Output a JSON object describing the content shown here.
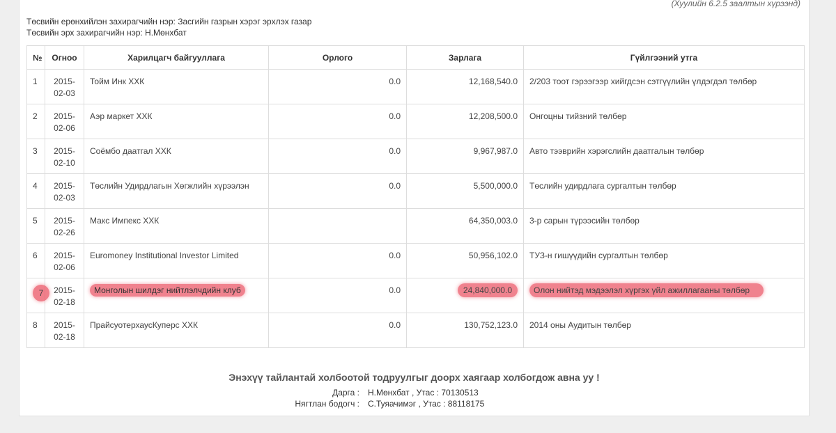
{
  "note": "(Хуулийн 6.2.5 заалтын хүрээнд)",
  "meta": {
    "line1": "Төсвийн ерөнхийлэн захирагчийн нэр: Засгийн газрын хэрэг эрхлэх газар",
    "line2": "Төсвийн эрх захирагчийн нэр: Н.Мөнхбат"
  },
  "table": {
    "headers": [
      "№",
      "Огноо",
      "Харилцагч байгууллага",
      "Орлого",
      "Зарлага",
      "Гүйлгээний утга"
    ],
    "rows": [
      {
        "no": "1",
        "date": "2015-\n02-03",
        "org": "Тойм Инк ХХК",
        "income": "0.0",
        "expense": "12,168,540.0",
        "purpose": "2/203 тоот гэрээгээр хийгдсэн сэтгүүлийн үлдэгдэл төлбөр"
      },
      {
        "no": "2",
        "date": "2015-\n02-06",
        "org": "Аэр маркет ХХК",
        "income": "0.0",
        "expense": "12,208,500.0",
        "purpose": "Онгоцны тийзний төлбөр"
      },
      {
        "no": "3",
        "date": "2015-\n02-10",
        "org": "Соёмбо даатгал ХХК",
        "income": "0.0",
        "expense": "9,967,987.0",
        "purpose": "Авто тээврийн хэрэгслийн даатгалын төлбөр"
      },
      {
        "no": "4",
        "date": "2015-\n02-03",
        "org": "Төслийн Удирдлагын Хөгжлийн хүрээлэн",
        "income": "0.0",
        "expense": "5,500,000.0",
        "purpose": "Төслийн удирдлага сургалтын төлбөр"
      },
      {
        "no": "5",
        "date": "2015-\n02-26",
        "org": "Макс Импекс ХХК",
        "income": "",
        "expense": "64,350,003.0",
        "purpose": "3-р сарын түрээсийн төлбөр"
      },
      {
        "no": "6",
        "date": "2015-\n02-06",
        "org": "Euromoney Institutional Investor Limited",
        "income": "0.0",
        "expense": "50,956,102.0",
        "purpose": "ТУЗ-н гишүүдийн сургалтын төлбөр"
      },
      {
        "no": "7",
        "date": "2015-\n02-18",
        "org": "Монголын шилдэг нийтлэлчдийн клуб",
        "income": "0.0",
        "expense": "24,840,000.0",
        "purpose": "Олон нийтэд мэдээлэл хүргэх үйл ажиллагааны төлбөр",
        "highlighted": true
      },
      {
        "no": "8",
        "date": "2015-\n02-18",
        "org": "ПрайсуотерхаусКуперс ХХК",
        "income": "0.0",
        "expense": "130,752,123.0",
        "purpose": "2014 оны Аудитын төлбөр"
      }
    ]
  },
  "footer": {
    "title": "Энэхүү тайлантай холбоотой тодруулгыг доорх хаягаар холбогдож авна уу !",
    "contact1_label": "Дарга :",
    "contact1_value": "Н.Мөнхбат , Утас : 70130513",
    "contact2_label": "Нягтлан бодогч :",
    "contact2_value": "С.Туяачимэг , Утас : 88118175"
  },
  "colors": {
    "highlight": "#ec5f6e",
    "background": "#efefef"
  }
}
